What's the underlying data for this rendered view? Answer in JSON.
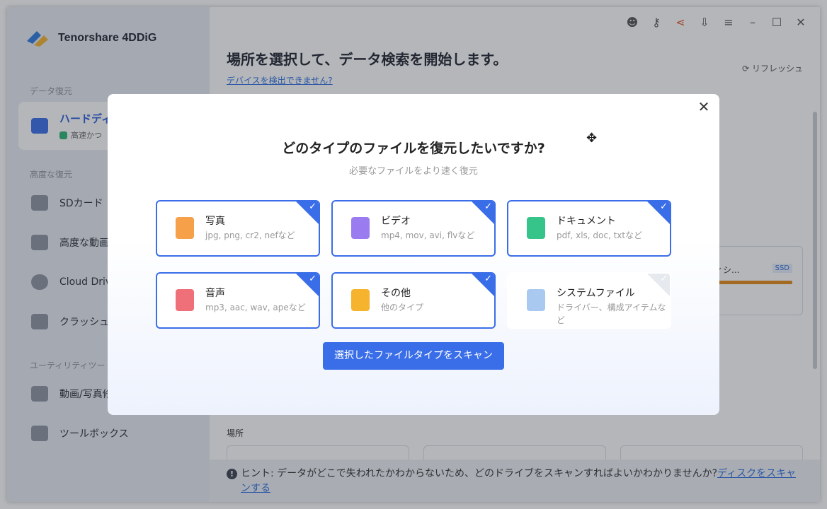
{
  "app": {
    "title": "Tenorshare 4DDiG"
  },
  "sidebar": {
    "section_recovery": "データ復元",
    "active_item": {
      "label": "ハードディ",
      "sub": "高速かつ"
    },
    "section_advanced": "高度な復元",
    "items": [
      {
        "label": "SDカード"
      },
      {
        "label": "高度な動画"
      },
      {
        "label": "Cloud Driv"
      },
      {
        "label": "クラッシュ"
      }
    ],
    "section_utility": "ユーティリティツー",
    "utility_items": [
      {
        "label": "動画/写真修"
      },
      {
        "label": "ツールボックス"
      }
    ]
  },
  "toolbar": {
    "icons": [
      "robot-icon",
      "key-icon",
      "share-icon",
      "download-icon",
      "menu-icon",
      "minimize-icon",
      "maximize-icon",
      "close-icon"
    ]
  },
  "main": {
    "title": "場所を選択して、データ検索を開始します。",
    "device_link": "デバイスを検出できません?",
    "refresh": "リフレッシュ",
    "disk": {
      "name": "ィシ...",
      "badge": "SSD"
    },
    "location_label": "場所",
    "hint_prefix": "ヒント: データがどこで失われたかわからないため、どのドライブをスキャンすればよいかわかりませんか?",
    "hint_link": "ディスクをスキャンする"
  },
  "modal": {
    "title": "どのタイプのファイルを復元したいですか?",
    "subtitle": "必要なファイルをより速く復元",
    "cards": [
      {
        "name": "写真",
        "exts": "jpg, png, cr2, nefなど",
        "selected": true,
        "color": "#f7a04a"
      },
      {
        "name": "ビデオ",
        "exts": "mp4, mov, avi, flvなど",
        "selected": true,
        "color": "#9b7cf0"
      },
      {
        "name": "ドキュメント",
        "exts": "pdf, xls, doc, txtなど",
        "selected": true,
        "color": "#36c48a"
      },
      {
        "name": "音声",
        "exts": "mp3, aac, wav, apeなど",
        "selected": true,
        "color": "#f0707a"
      },
      {
        "name": "その他",
        "exts": "他のタイプ",
        "selected": true,
        "color": "#f5b32e"
      },
      {
        "name": "システムファイル",
        "exts": "ドライバー、構成アイテムなど",
        "selected": false,
        "color": "#a9c9f0"
      }
    ],
    "scan_button": "選択したファイルタイプをスキャン"
  },
  "colors": {
    "accent": "#3a6ee8",
    "link": "#2d6fe0"
  }
}
